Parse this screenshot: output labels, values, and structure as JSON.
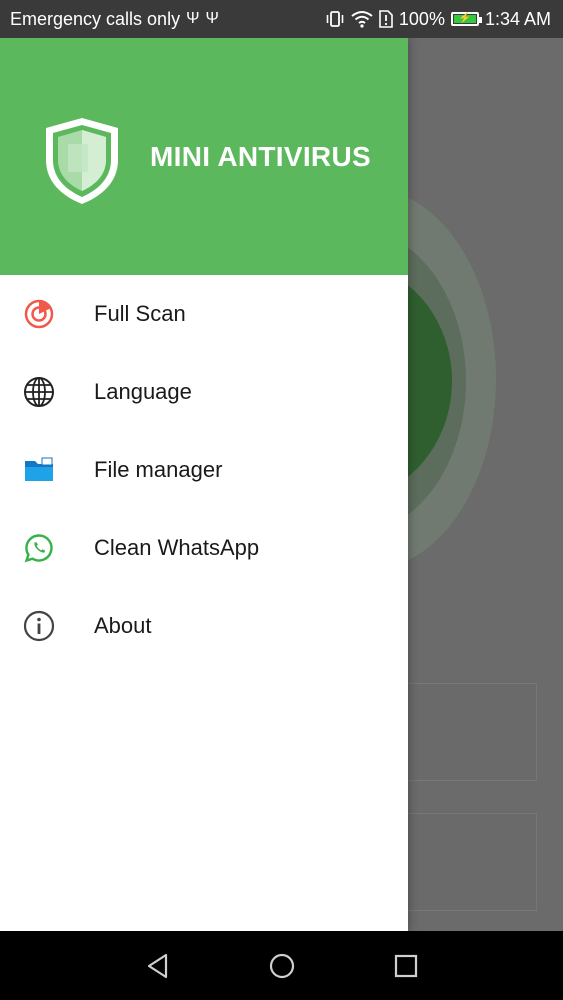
{
  "status_bar": {
    "left_text": "Emergency calls only",
    "usb_icons": [
      "usb-icon",
      "usb-icon"
    ],
    "battery_percent": "100%",
    "time": "1:34 AM",
    "icons": [
      "vibrate-icon",
      "wifi-icon",
      "sim-alert-icon",
      "battery-charging-icon"
    ]
  },
  "drawer": {
    "app_title": "MINI ANTIVIRUS",
    "logo_icon": "shield-icon",
    "header_color": "#5cb85c",
    "items": [
      {
        "label": "Full Scan",
        "icon": "radar-scan-icon",
        "icon_color": "#f05a4a"
      },
      {
        "label": "Language",
        "icon": "globe-icon",
        "icon_color": "#222222"
      },
      {
        "label": "File manager",
        "icon": "folder-icon",
        "icon_color": "#1ea3e8"
      },
      {
        "label": "Clean WhatsApp",
        "icon": "whatsapp-icon",
        "icon_color": "#35b34a"
      },
      {
        "label": "About",
        "icon": "info-icon",
        "icon_color": "#444444"
      }
    ]
  },
  "nav_bar": {
    "buttons": [
      "back-icon",
      "home-icon",
      "recents-icon"
    ]
  }
}
